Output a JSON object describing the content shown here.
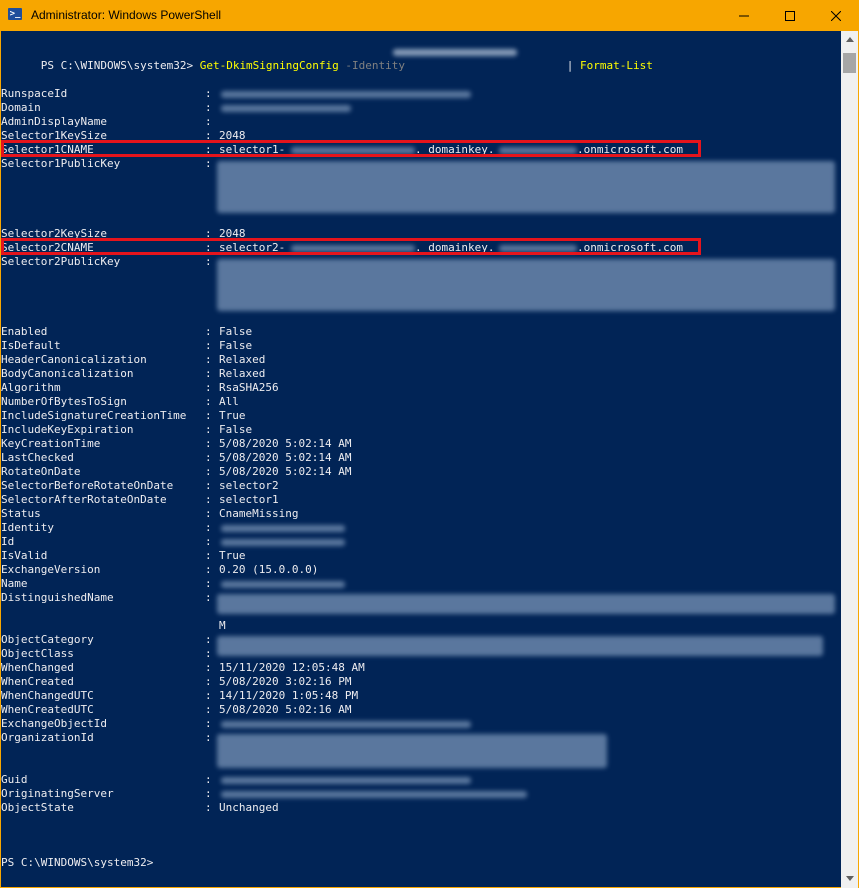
{
  "window": {
    "title": "Administrator: Windows PowerShell",
    "app_icon": "powershell-icon",
    "buttons": [
      "minimize-icon",
      "maximize-icon",
      "close-icon"
    ],
    "title_color": "#f7a600",
    "console_background": "#012456"
  },
  "command": {
    "prompt": "PS C:\\WINDOWS\\system32> ",
    "cmdlet": "Get-DkimSigningConfig",
    "parameter": "-Identity",
    "pipe": "|",
    "pipe_cmdlet": "Format-List"
  },
  "props": {
    "runspace_id": "RunspaceId",
    "domain": "Domain",
    "admin_display_name": "AdminDisplayName",
    "selector1_key_size": "Selector1KeySize",
    "selector1_cname": "Selector1CNAME",
    "selector1_public_key": "Selector1PublicKey",
    "selector2_key_size": "Selector2KeySize",
    "selector2_cname": "Selector2CNAME",
    "selector2_public_key": "Selector2PublicKey",
    "enabled": "Enabled",
    "is_default": "IsDefault",
    "header_canonicalization": "HeaderCanonicalization",
    "body_canonicalization": "BodyCanonicalization",
    "algorithm": "Algorithm",
    "number_of_bytes_to_sign": "NumberOfBytesToSign",
    "include_signature_creation_time": "IncludeSignatureCreationTime",
    "include_key_expiration": "IncludeKeyExpiration",
    "key_creation_time": "KeyCreationTime",
    "last_checked": "LastChecked",
    "rotate_on_date": "RotateOnDate",
    "selector_before_rotate_on_date": "SelectorBeforeRotateOnDate",
    "selector_after_rotate_on_date": "SelectorAfterRotateOnDate",
    "status": "Status",
    "identity": "Identity",
    "id": "Id",
    "is_valid": "IsValid",
    "exchange_version": "ExchangeVersion",
    "name": "Name",
    "distinguished_name": "DistinguishedName",
    "object_category": "ObjectCategory",
    "object_class": "ObjectClass",
    "when_changed": "WhenChanged",
    "when_created": "WhenCreated",
    "when_changed_utc": "WhenChangedUTC",
    "when_created_utc": "WhenCreatedUTC",
    "exchange_object_id": "ExchangeObjectId",
    "organization_id": "OrganizationId",
    "guid": "Guid",
    "originating_server": "OriginatingServer",
    "object_state": "ObjectState"
  },
  "values": {
    "selector1_key_size": "2048",
    "selector1_cname_prefix": "selector1-",
    "selector1_cname_mid": "._domainkey.",
    "selector1_cname_suffix": ".onmicrosoft.com",
    "selector2_key_size": "2048",
    "selector2_cname_prefix": "selector2-",
    "selector2_cname_mid": "._domainkey.",
    "selector2_cname_suffix": ".onmicrosoft.com",
    "enabled": "False",
    "is_default": "False",
    "header_canonicalization": "Relaxed",
    "body_canonicalization": "Relaxed",
    "algorithm": "RsaSHA256",
    "number_of_bytes_to_sign": "All",
    "include_signature_creation_time": "True",
    "include_key_expiration": "False",
    "key_creation_time": "5/08/2020 5:02:14 AM",
    "last_checked": "5/08/2020 5:02:14 AM",
    "rotate_on_date": "5/08/2020 5:02:14 AM",
    "selector_before_rotate_on_date": "selector2",
    "selector_after_rotate_on_date": "selector1",
    "status": "CnameMissing",
    "is_valid": "True",
    "exchange_version": "0.20 (15.0.0.0)",
    "distinguished_name_tail": "M",
    "when_changed": "15/11/2020 12:05:48 AM",
    "when_created": "5/08/2020 3:02:16 PM",
    "when_changed_utc": "14/11/2020 1:05:48 PM",
    "when_created_utc": "5/08/2020 5:02:16 AM",
    "object_state": "Unchanged"
  },
  "separator": ":",
  "final_prompt": "PS C:\\WINDOWS\\system32>",
  "highlight_color": "#e5141c"
}
